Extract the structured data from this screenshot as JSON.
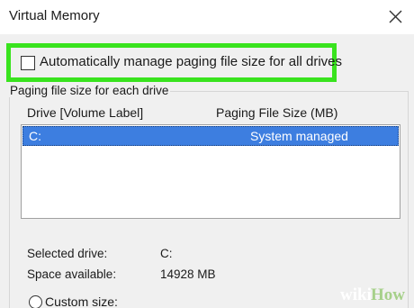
{
  "window": {
    "title": "Virtual Memory"
  },
  "auto_manage": {
    "label": "Automatically manage paging file size for all drives",
    "checked": false,
    "highlight_color": "#39e31e"
  },
  "paging_group": {
    "title": "Paging file size for each drive",
    "columns": {
      "drive": "Drive  [Volume Label]",
      "size": "Paging File Size (MB)"
    },
    "rows": [
      {
        "drive": "C:",
        "size": "System managed",
        "selected": true
      }
    ],
    "selection_color": "#3d7ee0"
  },
  "drive_info": {
    "selected_drive_label": "Selected drive:",
    "selected_drive_value": "C:",
    "space_available_label": "Space available:",
    "space_available_value": "14928 MB"
  },
  "custom_size": {
    "label": "Custom size:",
    "selected": false
  },
  "watermark": {
    "wiki": "wiki",
    "how": "How"
  },
  "icons": {
    "close": "close-icon"
  }
}
